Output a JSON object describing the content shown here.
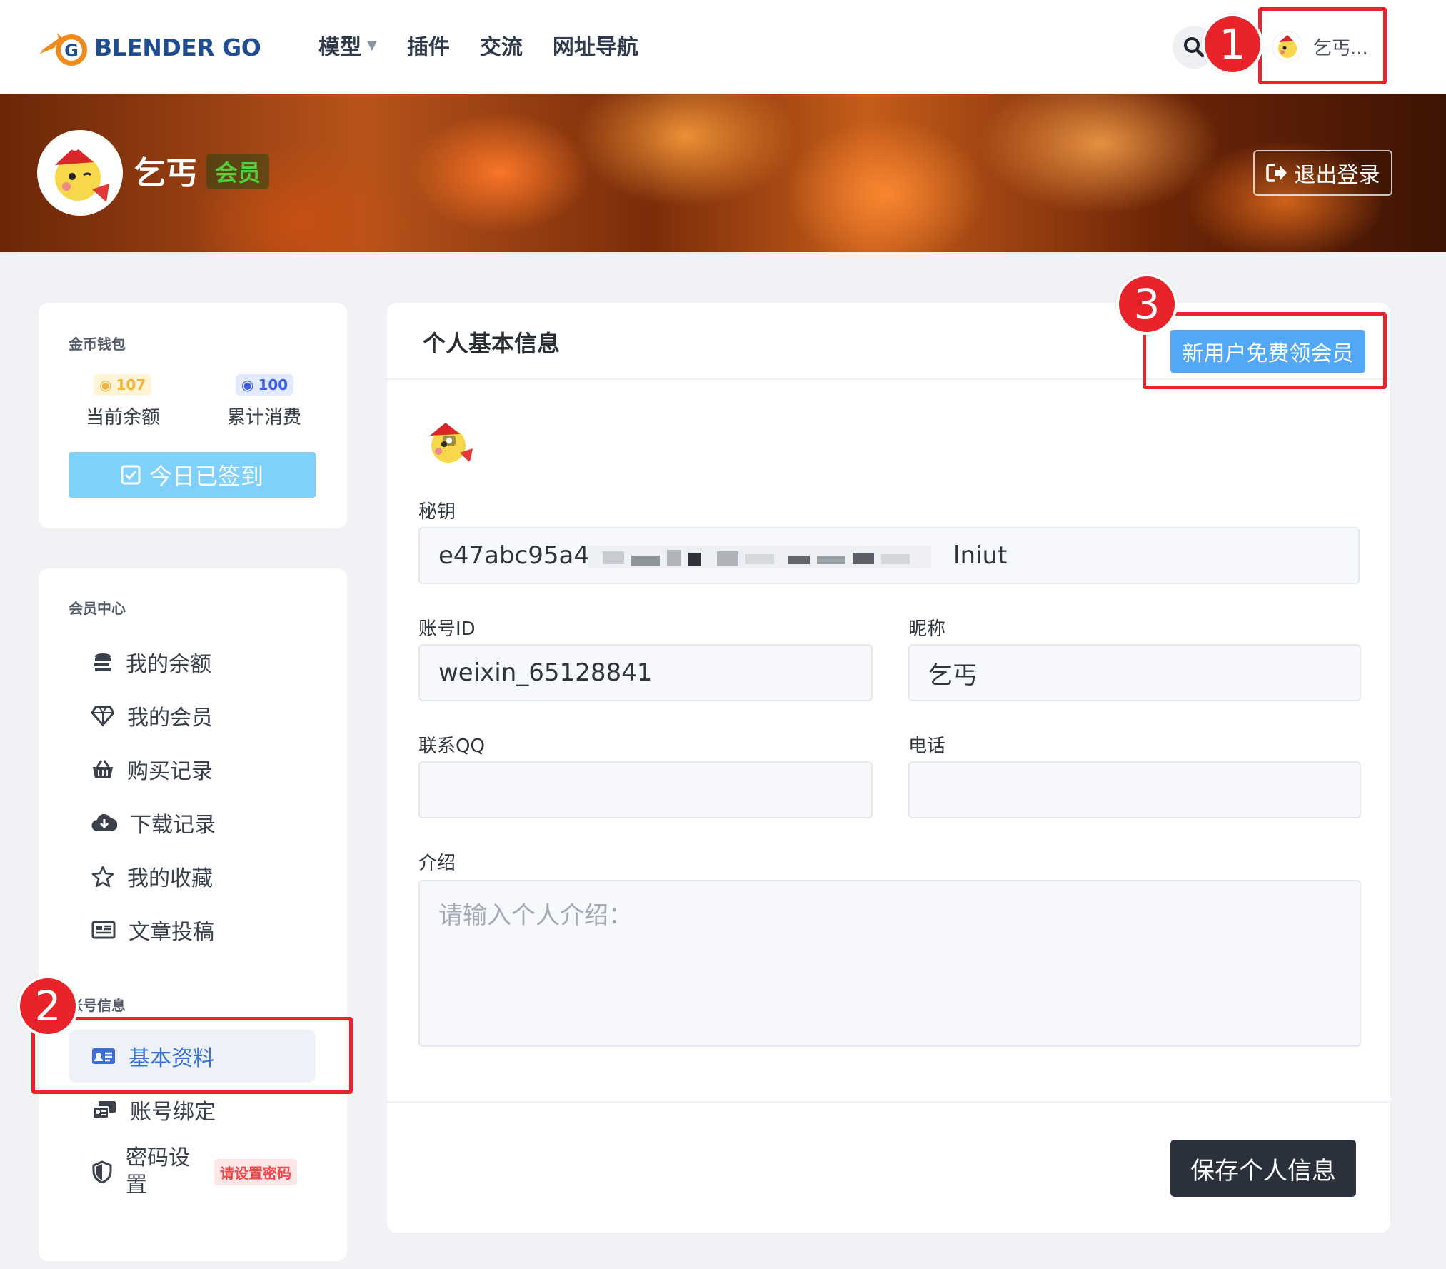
{
  "brand": {
    "name": "BLENDER GO",
    "accent": "#f08a1c",
    "primary": "#1f4d8f"
  },
  "nav": {
    "items": [
      {
        "label": "模型",
        "has_dropdown": true
      },
      {
        "label": "插件"
      },
      {
        "label": "交流"
      },
      {
        "label": "网址导航"
      }
    ],
    "search_icon": "search-icon",
    "user_short_name": "乞丐..."
  },
  "banner": {
    "user_name": "乞丐",
    "member_badge": "会员",
    "logout_label": "退出登录"
  },
  "wallet": {
    "title": "金币钱包",
    "balance_value": "107",
    "balance_label": "当前余额",
    "spent_value": "100",
    "spent_label": "累计消费",
    "signin_label": "今日已签到"
  },
  "menu": {
    "section_member": "会员中心",
    "member_items": [
      {
        "label": "我的余额",
        "icon": "coins-icon"
      },
      {
        "label": "我的会员",
        "icon": "diamond-icon"
      },
      {
        "label": "购买记录",
        "icon": "basket-icon"
      },
      {
        "label": "下载记录",
        "icon": "cloud-download-icon"
      },
      {
        "label": "我的收藏",
        "icon": "star-icon"
      },
      {
        "label": "文章投稿",
        "icon": "newspaper-icon"
      }
    ],
    "section_account": "账号信息",
    "account_items": [
      {
        "label": "基本资料",
        "icon": "id-card-icon",
        "active": true
      },
      {
        "label": "账号绑定",
        "icon": "link-account-icon"
      },
      {
        "label": "密码设置",
        "icon": "shield-icon",
        "tag": "请设置密码"
      }
    ]
  },
  "profile": {
    "title": "个人基本信息",
    "vip_button": "新用户免费领会员",
    "secret_label": "秘钥",
    "secret_value_start": "e47abc95a4",
    "secret_value_end": "lniut",
    "account_id_label": "账号ID",
    "account_id_value": "weixin_65128841",
    "nickname_label": "昵称",
    "nickname_value": "乞丐",
    "qq_label": "联系QQ",
    "qq_value": "",
    "phone_label": "电话",
    "phone_value": "",
    "intro_label": "介绍",
    "intro_placeholder": "请输入个人介绍：",
    "save_button": "保存个人信息"
  },
  "annotations": [
    "1",
    "2",
    "3"
  ],
  "colors": {
    "annotation": "#e8232a",
    "vip_button": "#52a8f7",
    "signin_button": "#7fd1fb",
    "save_button": "#2a313c",
    "member_badge": "#53d13a"
  }
}
